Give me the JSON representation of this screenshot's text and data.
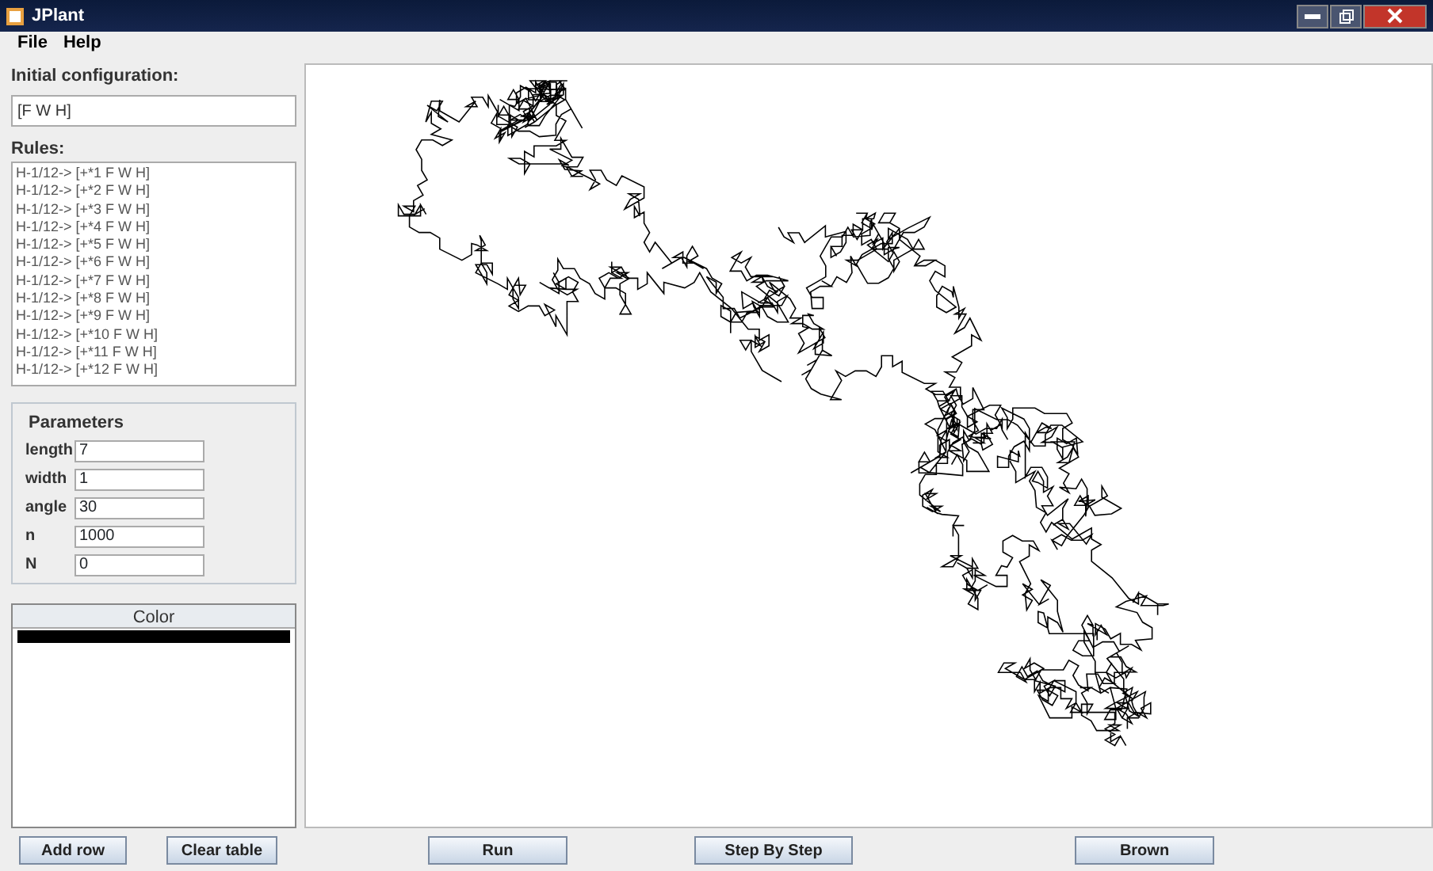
{
  "window": {
    "title": "JPlant"
  },
  "menu": [
    "File",
    "Help"
  ],
  "initial_configuration": {
    "label": "Initial configuration:",
    "value": "[F W H]"
  },
  "rules": {
    "label": "Rules:",
    "items": [
      "H-1/12-> [+*1 F W H]",
      "H-1/12-> [+*2 F W H]",
      "H-1/12-> [+*3 F W H]",
      "H-1/12-> [+*4 F W H]",
      "H-1/12-> [+*5 F W H]",
      "H-1/12-> [+*6 F W H]",
      "H-1/12-> [+*7 F W H]",
      "H-1/12-> [+*8 F W H]",
      "H-1/12-> [+*9 F W H]",
      "H-1/12-> [+*10 F W H]",
      "H-1/12-> [+*11 F W H]",
      "H-1/12-> [+*12 F W H]"
    ]
  },
  "parameters": {
    "title": "Parameters",
    "fields": [
      {
        "label": "length",
        "value": "7"
      },
      {
        "label": "width",
        "value": "1"
      },
      {
        "label": "angle",
        "value": "30"
      },
      {
        "label": "n",
        "value": "1000"
      },
      {
        "label": "N",
        "value": "0"
      }
    ]
  },
  "color_table": {
    "header": "Color",
    "rows": [
      {
        "color": "#000000"
      }
    ]
  },
  "buttons": [
    "Add row",
    "Clear table",
    "Run",
    "Step By Step",
    "Brown"
  ]
}
